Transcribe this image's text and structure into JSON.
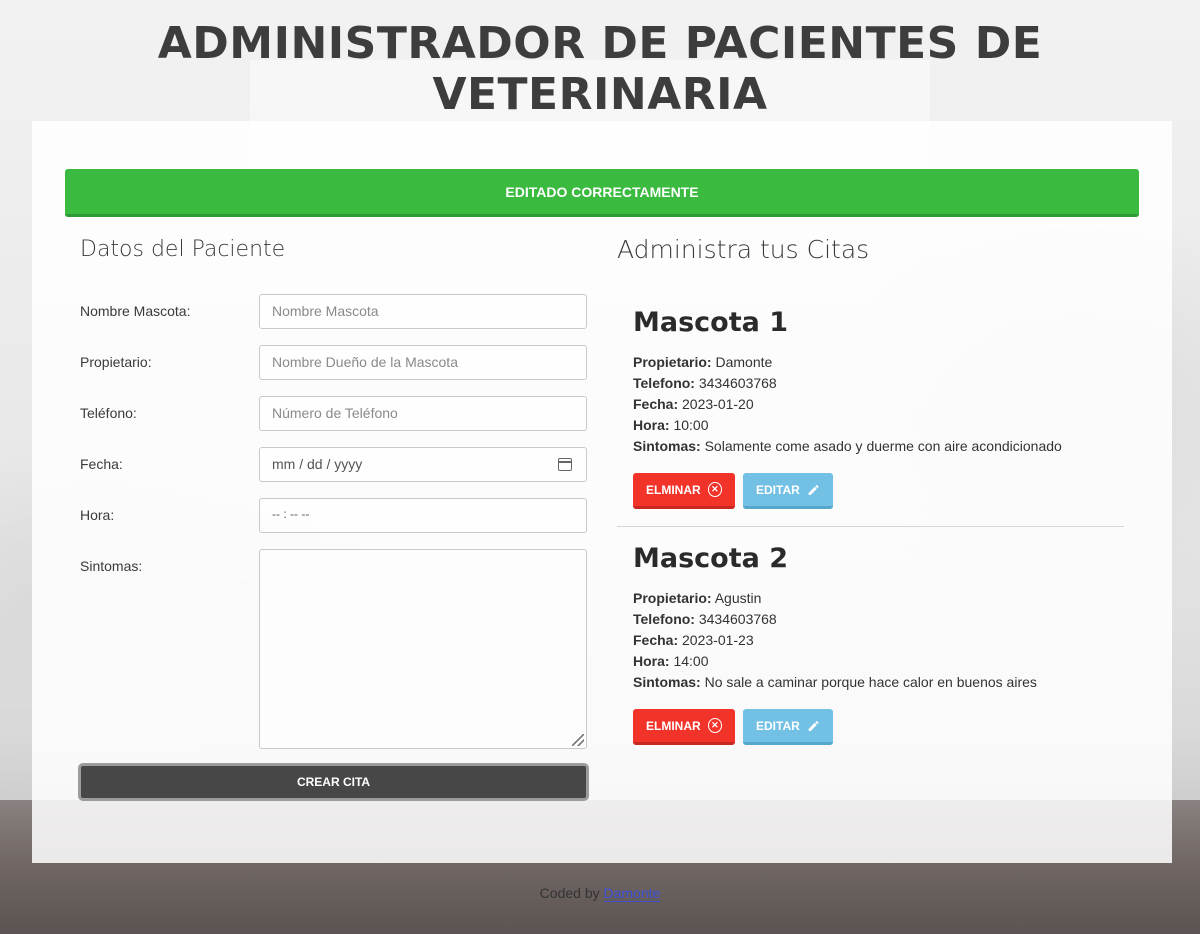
{
  "header": {
    "title": "ADMINISTRADOR DE PACIENTES DE VETERINARIA"
  },
  "alert": {
    "message": "EDITADO CORRECTAMENTE",
    "color": "#3aba3e"
  },
  "form": {
    "title": "Datos del Paciente",
    "fields": [
      {
        "label": "Nombre Mascota:",
        "placeholder": "Nombre Mascota"
      },
      {
        "label": "Propietario:",
        "placeholder": "Nombre Dueño de la Mascota"
      },
      {
        "label": "Teléfono:",
        "placeholder": "Número de Teléfono"
      },
      {
        "label": "Fecha:",
        "placeholder": "mm / dd / yyyy"
      },
      {
        "label": "Hora:",
        "placeholder": "-- : --   --"
      },
      {
        "label": "Sintomas:",
        "placeholder": ""
      }
    ],
    "submit_label": "CREAR CITA"
  },
  "citas": {
    "title": "Administra tus Citas",
    "labels": {
      "owner": "Propietario:",
      "phone": "Telefono:",
      "date": "Fecha:",
      "time": "Hora:",
      "symptoms": "Sintomas:"
    },
    "items": [
      {
        "pet": "Mascota 1",
        "owner": "Damonte",
        "phone": "3434603768",
        "date": "2023-01-20",
        "time": "10:00",
        "symptoms": "Solamente come asado y duerme con aire acondicionado",
        "delete_label": "ELMINAR",
        "edit_label": "EDITAR"
      },
      {
        "pet": "Mascota 2",
        "owner": "Agustin",
        "phone": "3434603768",
        "date": "2023-01-23",
        "time": "14:00",
        "symptoms": "No sale a caminar porque hace calor en buenos aires",
        "delete_label": "ELMINAR",
        "edit_label": "EDITAR"
      }
    ]
  },
  "footer": {
    "prefix": "Coded by ",
    "author": "Damonte"
  },
  "colors": {
    "delete": "#f2332a",
    "edit": "#72c0e3",
    "submit": "#474747"
  }
}
